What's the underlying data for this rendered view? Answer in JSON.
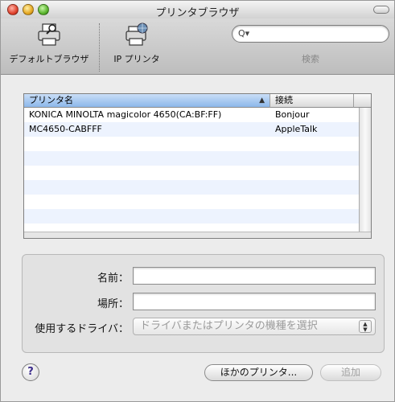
{
  "window": {
    "title": "プリンタブラウザ"
  },
  "toolbar": {
    "default_label": "デフォルトブラウザ",
    "ip_label": "IP プリンタ",
    "search_placeholder": "",
    "search_label": "検索",
    "icons": {
      "default": "printer-magnifier-icon",
      "ip": "printer-globe-icon",
      "search": "search-icon"
    }
  },
  "list": {
    "columns": {
      "name": "プリンタ名",
      "connection": "接続"
    },
    "sort_indicator": "▲",
    "rows": [
      {
        "name": "KONICA MINOLTA magicolor 4650(CA:BF:FF)",
        "connection": "Bonjour"
      },
      {
        "name": "MC4650-CABFFF",
        "connection": "AppleTalk"
      },
      {
        "name": "",
        "connection": ""
      },
      {
        "name": "",
        "connection": ""
      },
      {
        "name": "",
        "connection": ""
      },
      {
        "name": "",
        "connection": ""
      },
      {
        "name": "",
        "connection": ""
      },
      {
        "name": "",
        "connection": ""
      }
    ]
  },
  "form": {
    "name_label": "名前：",
    "name_value": "",
    "location_label": "場所：",
    "location_value": "",
    "driver_label": "使用するドライバ：",
    "driver_value": "ドライバまたはプリンタの機種を選択"
  },
  "buttons": {
    "help": "?",
    "other_printers": "ほかのプリンタ...",
    "add": "追加"
  },
  "colors": {
    "header_selected": "#8cb7ea",
    "row_alt": "#edf3fe",
    "help_question": "#3b2b8a"
  }
}
